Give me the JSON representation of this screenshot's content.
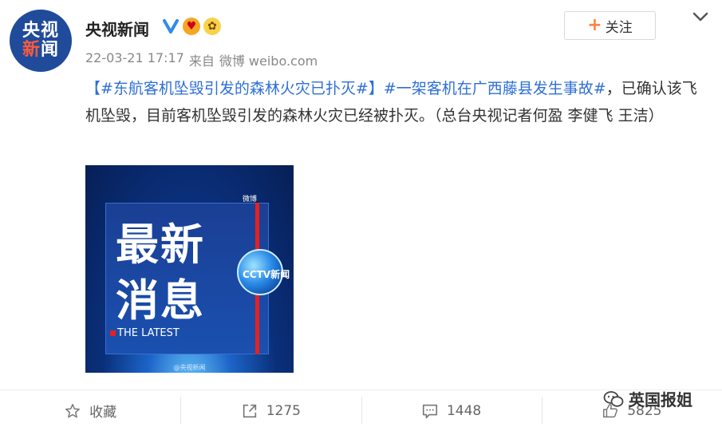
{
  "author": {
    "avatar_line1": "央视",
    "avatar_line2_a": "新",
    "avatar_line2_b": "闻",
    "name": "央视新闻",
    "badges": [
      "verified-icon",
      "gold-medal-icon",
      "flower-icon"
    ]
  },
  "meta": {
    "timestamp": "22-03-21 17:17",
    "source_prefix": "来自",
    "source": "微博 weibo.com"
  },
  "follow": {
    "plus": "+",
    "label": "关注"
  },
  "post": {
    "tag1": "【#东航客机坠毁引发的森林火灾已扑灭#】",
    "tag2": "#一架客机在广西藤县发生事故#",
    "text": "，已确认该飞机坠毁，目前客机坠毁引发的森林火灾已经被扑灭。（总台央视记者何盈 李健飞 王洁）"
  },
  "image": {
    "big_line1": "最新",
    "big_line2": "消息",
    "subtitle": "THE LATEST",
    "logo_text": "CCTV新闻",
    "weibo_mark": "微博",
    "footer": "@央视新闻"
  },
  "actions": {
    "favorite": "收藏",
    "repost": "1275",
    "comment": "1448",
    "like": "5825"
  },
  "watermark": {
    "label": "英国报姐"
  },
  "colors": {
    "link": "#2f6fd6",
    "accent": "#ff8140",
    "avatar_bg": "#1f4b9a"
  }
}
